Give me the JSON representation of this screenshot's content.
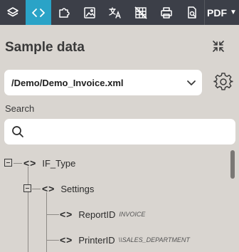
{
  "toolbar": {
    "buttons": [
      {
        "name": "layers-icon",
        "active": false
      },
      {
        "name": "code-icon",
        "active": true
      },
      {
        "name": "puzzle-icon",
        "active": false
      },
      {
        "name": "image-icon",
        "active": false
      },
      {
        "name": "translate-icon",
        "active": false
      },
      {
        "name": "grid-disabled-icon",
        "active": false
      },
      {
        "name": "printer-icon",
        "active": false
      },
      {
        "name": "document-search-icon",
        "active": false
      }
    ],
    "export_label": "PDF",
    "accent_color": "#2aa3c7",
    "background_color": "#3c3f48"
  },
  "panel": {
    "title": "Sample data"
  },
  "file_select": {
    "value": "/Demo/Demo_Invoice.xml"
  },
  "search": {
    "label": "Search",
    "value": ""
  },
  "tree": {
    "nodes": [
      {
        "label": "IF_Type",
        "value": ""
      },
      {
        "label": "Settings",
        "value": ""
      },
      {
        "label": "ReportID",
        "value": "INVOICE"
      },
      {
        "label": "PrinterID",
        "value": "\\\\SALES_DEPARTMENT"
      }
    ]
  }
}
